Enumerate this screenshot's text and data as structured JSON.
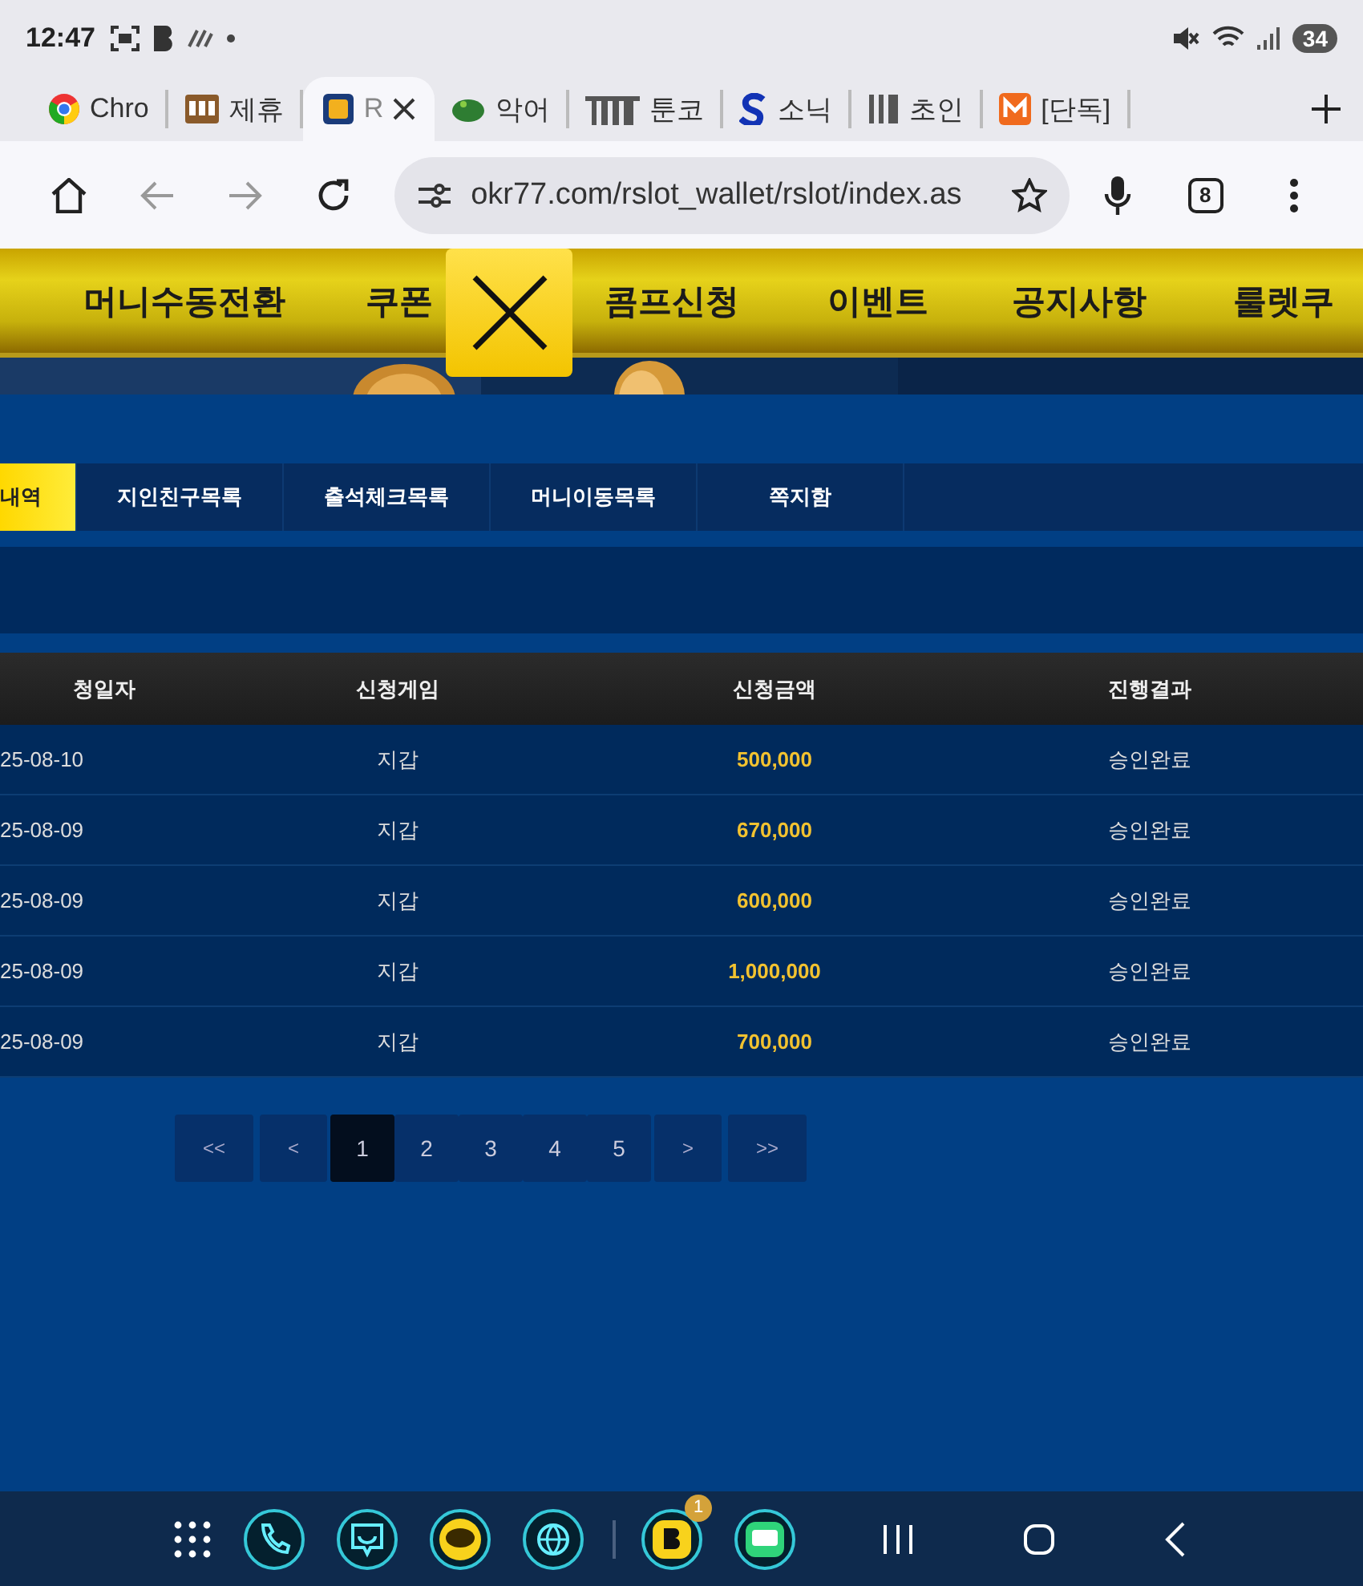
{
  "status_bar": {
    "time": "12:47",
    "battery": "34"
  },
  "browser_tabs": [
    {
      "title": "Chro",
      "selected": false
    },
    {
      "title": "제휴",
      "selected": false
    },
    {
      "title": "R",
      "selected": true
    },
    {
      "title": "악어",
      "selected": false
    },
    {
      "title": "툰코",
      "selected": false
    },
    {
      "title": "소닉",
      "selected": false
    },
    {
      "title": "초인",
      "selected": false
    },
    {
      "title": "[단독]",
      "selected": false
    }
  ],
  "toolbar": {
    "url": "okr77.com/rslot_wallet/rslot/index.as",
    "tab_count": "8"
  },
  "site_nav": [
    "머니수동전환",
    "쿠폰",
    "콤프신청",
    "이벤트",
    "공지사항",
    "룰렛쿠"
  ],
  "sub_tabs": [
    {
      "label": "내역",
      "selected": true
    },
    {
      "label": "지인친구목록",
      "selected": false
    },
    {
      "label": "출석체크목록",
      "selected": false
    },
    {
      "label": "머니이동목록",
      "selected": false
    },
    {
      "label": "쪽지함",
      "selected": false
    }
  ],
  "table": {
    "columns": [
      "청일자",
      "신청게임",
      "신청금액",
      "진행결과"
    ],
    "rows": [
      {
        "date": "25-08-10",
        "game": "지갑",
        "amount": "500,000",
        "result": "승인완료"
      },
      {
        "date": "25-08-09",
        "game": "지갑",
        "amount": "670,000",
        "result": "승인완료"
      },
      {
        "date": "25-08-09",
        "game": "지갑",
        "amount": "600,000",
        "result": "승인완료"
      },
      {
        "date": "25-08-09",
        "game": "지갑",
        "amount": "1,000,000",
        "result": "승인완료"
      },
      {
        "date": "25-08-09",
        "game": "지갑",
        "amount": "700,000",
        "result": "승인완료"
      }
    ]
  },
  "pagination": [
    {
      "label": "<<",
      "selected": false
    },
    {
      "label": "<",
      "selected": false
    },
    {
      "label": "1",
      "selected": true
    },
    {
      "label": "2",
      "selected": false
    },
    {
      "label": "3",
      "selected": false
    },
    {
      "label": "4",
      "selected": false
    },
    {
      "label": "5",
      "selected": false
    },
    {
      "label": ">",
      "selected": false
    },
    {
      "label": ">>",
      "selected": false
    }
  ],
  "taskbar": {
    "badge": "1"
  }
}
